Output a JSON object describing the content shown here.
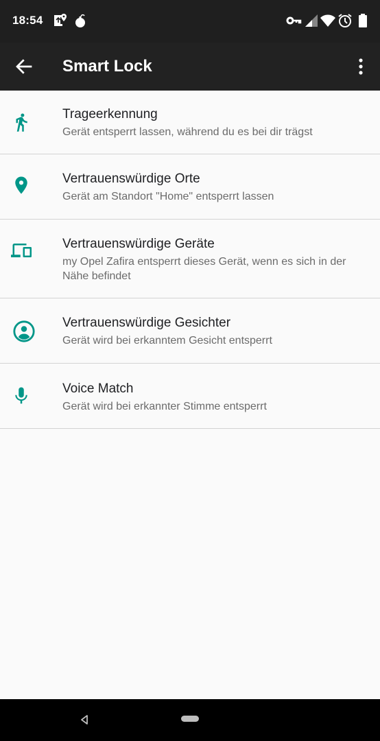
{
  "status_bar": {
    "time": "18:54",
    "left_icons": [
      "maps-notification-icon",
      "bomb-notification-icon"
    ],
    "right_icons": [
      "vpn-key-icon",
      "cellular-signal-icon",
      "wifi-icon",
      "alarm-icon",
      "battery-icon"
    ]
  },
  "toolbar": {
    "title": "Smart Lock",
    "back_icon": "arrow-back-icon",
    "menu_icon": "more-vert-icon"
  },
  "items": [
    {
      "icon": "walking-person-icon",
      "title": "Trageerkennung",
      "subtitle": "Gerät entsperrt lassen, während du es bei dir trägst"
    },
    {
      "icon": "location-pin-icon",
      "title": "Vertrauenswürdige Orte",
      "subtitle": "Gerät am Standort \"Home\" entsperrt lassen"
    },
    {
      "icon": "devices-icon",
      "title": "Vertrauenswürdige Geräte",
      "subtitle": "my Opel Zafira entsperrt dieses Gerät, wenn es sich in der Nähe befindet"
    },
    {
      "icon": "face-icon",
      "title": "Vertrauenswürdige Gesichter",
      "subtitle": "Gerät wird bei erkanntem Gesicht entsperrt"
    },
    {
      "icon": "microphone-icon",
      "title": "Voice Match",
      "subtitle": "Gerät wird bei erkannter Stimme entsperrt"
    }
  ],
  "colors": {
    "accent": "#009688",
    "toolbar_bg": "#222222",
    "statusbar_bg": "#1f1f1f",
    "background": "#fafafa",
    "primary_text": "#202124",
    "secondary_text": "#6b6b6b"
  }
}
